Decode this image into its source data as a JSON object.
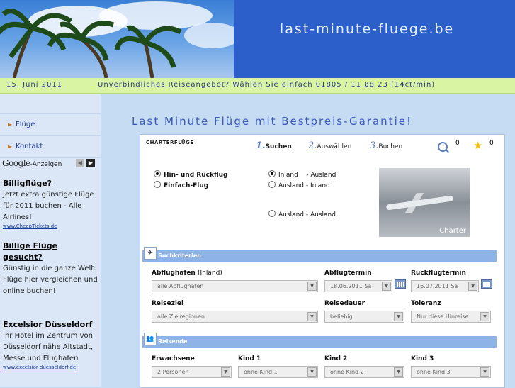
{
  "header": {
    "site_title": "last-minute-fluege.be"
  },
  "infobar": {
    "date": "15. Juni 2011",
    "notice": "Unverbindliches Reiseangebot? Wählen Sie einfach 01805 / 11 88 23 (14ct/min)"
  },
  "sidebar": {
    "nav": [
      {
        "label": "Flüge"
      },
      {
        "label": "Kontakt"
      }
    ],
    "ads_brand": "Google",
    "ads_label": "-Anzeigen",
    "ads": [
      {
        "title": "Billigflüge?",
        "text": "Jetzt extra günstige Flüge für 2011 buchen - Alle Airlines!",
        "url": "www.CheapTickets.de"
      },
      {
        "title": "Billige Flüge gesucht?",
        "text": "Günstig in die ganze Welt: Flüge hier vergleichen und online buchen!",
        "url": ""
      },
      {
        "title": "Excelsior Düsseldorf",
        "text": "Ihr Hotel im Zentrum von Düsseldorf nähe Altstadt, Messe und Flughafen",
        "url": "www.excelsior-duesseldorf.de"
      }
    ]
  },
  "main": {
    "heading": "Last Minute Flüge mit Bestpreis-Garantie!",
    "charter_title": "Charterflüge",
    "steps": [
      {
        "num": "1.",
        "label": "Suchen"
      },
      {
        "num": "2.",
        "label": "Auswählen"
      },
      {
        "num": "3.",
        "label": "Buchen"
      }
    ],
    "search_count": "0",
    "favorites_count": "0",
    "trip_type": [
      {
        "label": "Hin- und Rückflug",
        "checked": true
      },
      {
        "label": "Einfach-Flug",
        "checked": false
      }
    ],
    "route_type": [
      {
        "label": "Inland    - Ausland",
        "checked": true
      },
      {
        "label": "Ausland - Inland",
        "checked": false
      },
      {
        "label": "Ausland - Ausland",
        "checked": false
      }
    ],
    "charter_image_label": "Charter",
    "criteria": {
      "section_title": "Suchkriterien",
      "abflughafen_label": "Abflughafen",
      "abflughafen_note": "(Inland)",
      "abflughafen_value": "alle Abflughäfen",
      "abflugtermin_label": "Abflugtermin",
      "abflugtermin_value": "18.06.2011 Sa",
      "rueckflug_label": "Rückflugtermin",
      "rueckflug_value": "16.07.2011 Sa",
      "reiseziel_label": "Reiseziel",
      "reiseziel_value": "alle Zielregionen",
      "reisedauer_label": "Reisedauer",
      "reisedauer_value": "beliebig",
      "toleranz_label": "Toleranz",
      "toleranz_value": "Nur diese Hinreise"
    },
    "travelers": {
      "section_title": "Reisende",
      "erwachsene_label": "Erwachsene",
      "erwachsene_value": "2 Personen",
      "kind1_label": "Kind 1",
      "kind1_value": "ohne Kind 1",
      "kind2_label": "Kind 2",
      "kind2_value": "ohne Kind 2",
      "kind3_label": "Kind 3",
      "kind3_value": "ohne Kind 3"
    }
  }
}
